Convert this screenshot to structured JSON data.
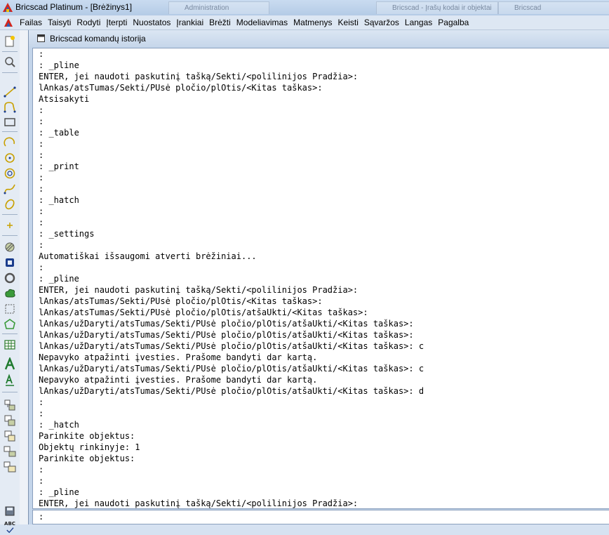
{
  "window": {
    "title": "Bricscad Platinum - [Brėžinys1]",
    "background_tabs": [
      "Administration",
      "Bricscad - Įrašų kodai ir objektai",
      "Bricscad"
    ]
  },
  "menu": {
    "items": [
      {
        "label": "Failas"
      },
      {
        "label": "Taisyti"
      },
      {
        "label": "Rodyti"
      },
      {
        "label": "Įterpti"
      },
      {
        "label": "Nuostatos"
      },
      {
        "label": "Įrankiai"
      },
      {
        "label": "Brėžti"
      },
      {
        "label": "Modeliavimas"
      },
      {
        "label": "Matmenys"
      },
      {
        "label": "Keisti"
      },
      {
        "label": "Sąvaržos"
      },
      {
        "label": "Langas"
      },
      {
        "label": "Pagalba"
      }
    ]
  },
  "toolbar": {
    "tools": [
      {
        "icon": "new-drawing-icon"
      },
      {
        "icon": "zoom-icon"
      },
      {
        "icon": "line-icon"
      },
      {
        "icon": "polyline-icon"
      },
      {
        "icon": "rectangle-icon"
      },
      {
        "icon": "arc-icon"
      },
      {
        "icon": "circle-icon"
      },
      {
        "icon": "circle-3point-icon"
      },
      {
        "icon": "spline-icon"
      },
      {
        "icon": "ellipse-icon"
      },
      {
        "icon": "point-icon"
      },
      {
        "icon": "hatch-icon"
      },
      {
        "icon": "region-icon"
      },
      {
        "icon": "donut-icon"
      },
      {
        "icon": "revision-cloud-icon"
      },
      {
        "icon": "wipeout-icon"
      },
      {
        "icon": "boundary-icon"
      },
      {
        "icon": "table-icon"
      },
      {
        "icon": "text-icon"
      },
      {
        "icon": "mtext-icon"
      },
      {
        "icon": "block-icon"
      },
      {
        "icon": "insert-block-icon"
      },
      {
        "icon": "xref-icon"
      },
      {
        "icon": "group-icon"
      },
      {
        "icon": "attribute-icon"
      },
      {
        "icon": "save-icon"
      },
      {
        "icon": "spellcheck-icon"
      }
    ],
    "spellcheck_label": "ABC"
  },
  "dialog": {
    "title": "Bricscad komandų istorija",
    "history_lines": [
      ":",
      ": _pline",
      "ENTER, jei naudoti paskutinį tašką/Sekti/<polilinijos Pradžia>:",
      "lAnkas/atsTumas/Sekti/PUsė pločio/plOtis/<Kitas taškas>:",
      "Atsisakyti",
      ":",
      ":",
      ": _table",
      ":",
      ":",
      ": _print",
      ":",
      ":",
      ": _hatch",
      ":",
      ":",
      ": _settings",
      ":",
      "Automatiškai išsaugomi atverti brėžiniai...",
      ":",
      ": _pline",
      "ENTER, jei naudoti paskutinį tašką/Sekti/<polilinijos Pradžia>:",
      "lAnkas/atsTumas/Sekti/PUsė pločio/plOtis/<Kitas taškas>:",
      "lAnkas/atsTumas/Sekti/PUsė pločio/plOtis/atšaUkti/<Kitas taškas>:",
      "lAnkas/užDaryti/atsTumas/Sekti/PUsė pločio/plOtis/atšaUkti/<Kitas taškas>:",
      "lAnkas/užDaryti/atsTumas/Sekti/PUsė pločio/plOtis/atšaUkti/<Kitas taškas>:",
      "lAnkas/užDaryti/atsTumas/Sekti/PUsė pločio/plOtis/atšaUkti/<Kitas taškas>: c",
      "Nepavyko atpažinti įvesties. Prašome bandyti dar kartą.",
      "lAnkas/užDaryti/atsTumas/Sekti/PUsė pločio/plOtis/atšaUkti/<Kitas taškas>: c",
      "Nepavyko atpažinti įvesties. Prašome bandyti dar kartą.",
      "lAnkas/užDaryti/atsTumas/Sekti/PUsė pločio/plOtis/atšaUkti/<Kitas taškas>: d",
      ":",
      ":",
      ": _hatch",
      "Parinkite objektus:",
      "Objektų rinkinyje: 1",
      "Parinkite objektus:",
      ":",
      ":",
      ": _pline",
      "ENTER, jei naudoti paskutinį tašką/Sekti/<polilinijos Pradžia>:"
    ],
    "command_prompt": ":"
  }
}
